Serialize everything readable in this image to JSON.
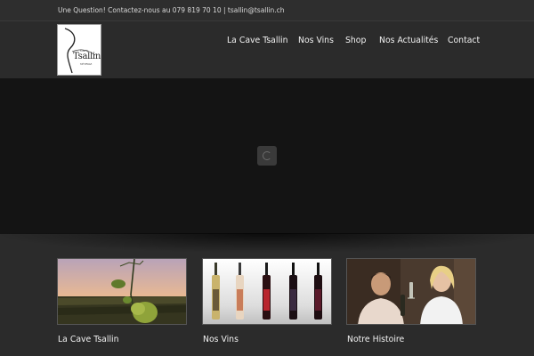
{
  "topbar": {
    "contact_text": "Une Question! Contactez-nous au 079 819 70 10 | tsallin@tsallin.ch"
  },
  "logo": {
    "small_text": "Cave",
    "name": "Tsallin",
    "place": "VÉTROZ"
  },
  "nav": {
    "items": [
      {
        "label": "La Cave Tsallin"
      },
      {
        "label": "Nos Vins"
      },
      {
        "label": "Shop"
      },
      {
        "label": "Nos Actualités"
      },
      {
        "label": "Contact"
      }
    ]
  },
  "hero": {
    "loader_icon": "spinner-icon"
  },
  "cards": [
    {
      "title": "La Cave Tsallin",
      "image": "vine-sunset-photo"
    },
    {
      "title": "Nos Vins",
      "image": "wine-bottles-photo"
    },
    {
      "title": "Notre Histoire",
      "image": "winemakers-photo"
    }
  ],
  "colors": {
    "background": "#2b2b2b",
    "hero": "#141414",
    "text": "#f2f2f2"
  }
}
